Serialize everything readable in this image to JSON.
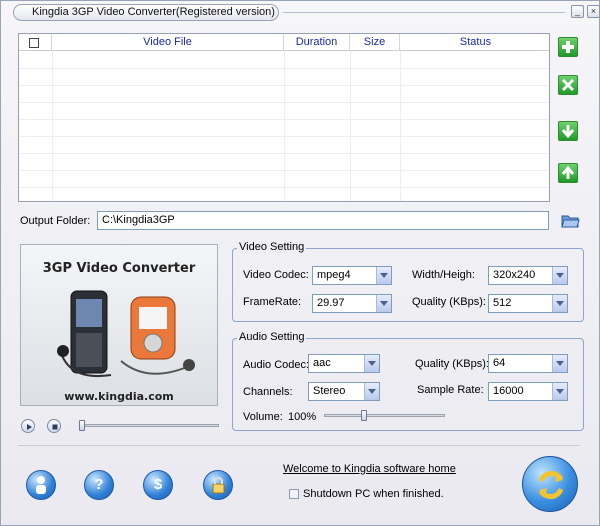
{
  "window": {
    "title": "Kingdia 3GP Video Converter(Registered version)"
  },
  "file_list": {
    "columns": [
      "Video File",
      "Duration",
      "Size",
      "Status"
    ]
  },
  "side_buttons": [
    "add-icon",
    "remove-icon",
    "move-down-icon",
    "move-up-icon"
  ],
  "output": {
    "label": "Output Folder:",
    "path": "C:\\Kingdia3GP"
  },
  "preview": {
    "title": "3GP Video Converter",
    "url": "www.kingdia.com"
  },
  "video_setting": {
    "title": "Video Setting",
    "codec_label": "Video Codec:",
    "codec_value": "mpeg4",
    "size_label": "Width/Heigh:",
    "size_value": "320x240",
    "framerate_label": "FrameRate:",
    "framerate_value": "29.97",
    "quality_label": "Quality (KBps):",
    "quality_value": "512"
  },
  "audio_setting": {
    "title": "Audio Setting",
    "codec_label": "Audio Codec:",
    "codec_value": "aac",
    "quality_label": "Quality (KBps):",
    "quality_value": "64",
    "channels_label": "Channels:",
    "channels_value": "Stereo",
    "samplerate_label": "Sample Rate:",
    "samplerate_value": "16000",
    "volume_label": "Volume:",
    "volume_value": "100%",
    "volume_level": 0.33
  },
  "playback": {
    "position": 0.0
  },
  "footer": {
    "welcome_link": "Welcome to Kingdia software home",
    "shutdown_label": "Shutdown PC when finished.",
    "icons": [
      "user-icon",
      "help-icon",
      "buy-icon",
      "register-icon"
    ]
  },
  "colors": {
    "accent_green": "#1f9a28",
    "header_text": "#1b2aa8",
    "group_border": "#8ea5cf"
  }
}
